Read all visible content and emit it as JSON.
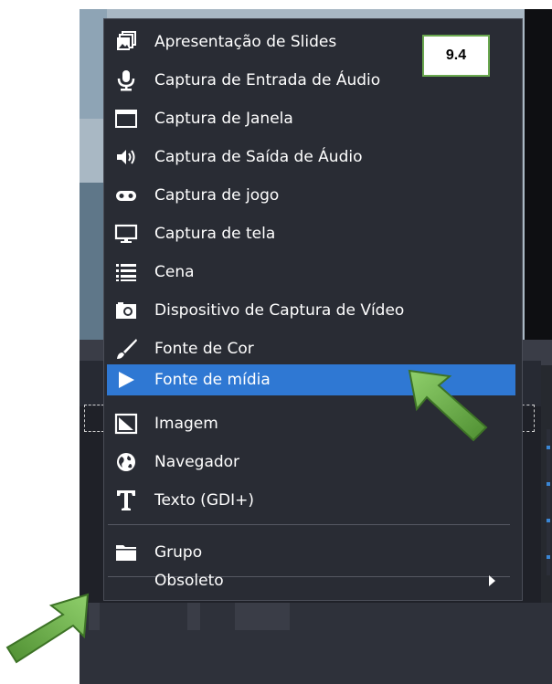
{
  "annotation": {
    "step_label": "9.4"
  },
  "menu": {
    "items": [
      {
        "label": "Apresentação de Slides",
        "icon": "slideshow-icon"
      },
      {
        "label": "Captura de Entrada de Áudio",
        "icon": "microphone-icon"
      },
      {
        "label": "Captura de Janela",
        "icon": "window-icon"
      },
      {
        "label": "Captura de Saída de Áudio",
        "icon": "speaker-icon"
      },
      {
        "label": "Captura de jogo",
        "icon": "gamepad-icon"
      },
      {
        "label": "Captura de tela",
        "icon": "monitor-icon"
      },
      {
        "label": "Cena",
        "icon": "list-icon"
      },
      {
        "label": "Dispositivo de Captura de Vídeo",
        "icon": "camera-icon"
      },
      {
        "label": "Fonte de Cor",
        "icon": "brush-icon"
      },
      {
        "label": "Fonte de mídia",
        "icon": "play-icon",
        "highlighted": true
      },
      {
        "label": "Imagem",
        "icon": "image-icon"
      },
      {
        "label": "Navegador",
        "icon": "globe-icon"
      },
      {
        "label": "Texto (GDI+)",
        "icon": "text-icon"
      },
      {
        "label": "Grupo",
        "icon": "folder-icon"
      },
      {
        "label": "Obsoleto",
        "icon": "",
        "submenu": true
      }
    ]
  },
  "colors": {
    "menu_background": "#292c34",
    "highlight": "#2f78d3",
    "annotation_arrow": "#6aa84f",
    "badge_border": "#6aa84f"
  }
}
